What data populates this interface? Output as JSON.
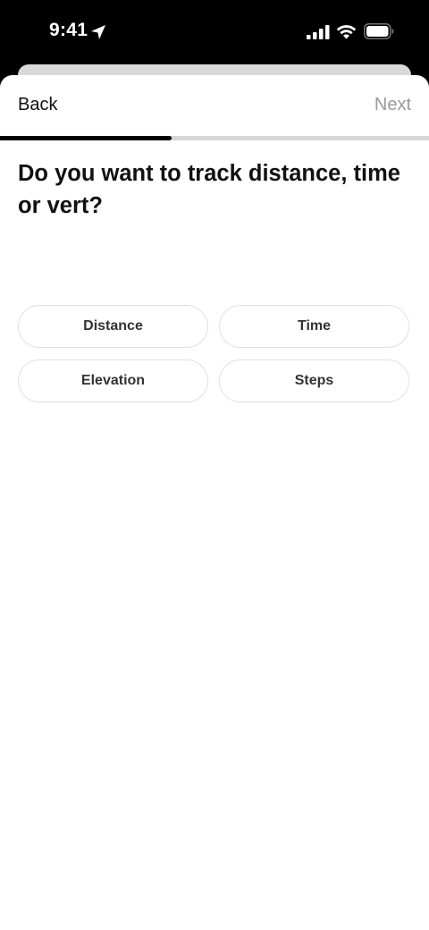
{
  "status_bar": {
    "time": "9:41",
    "icons": [
      "location-arrow-icon",
      "cellular-signal-icon",
      "wifi-icon",
      "battery-icon"
    ]
  },
  "nav": {
    "back_label": "Back",
    "next_label": "Next"
  },
  "progress": {
    "fraction": 0.4
  },
  "question": "Do you want to track distance, time or vert?",
  "options": [
    {
      "label": "Distance"
    },
    {
      "label": "Time"
    },
    {
      "label": "Elevation"
    },
    {
      "label": "Steps"
    }
  ],
  "colors": {
    "progress_fill": "#000000",
    "progress_track": "#d6d6d6",
    "next_disabled": "#9a9a9a",
    "option_border": "#e0e0e0"
  }
}
